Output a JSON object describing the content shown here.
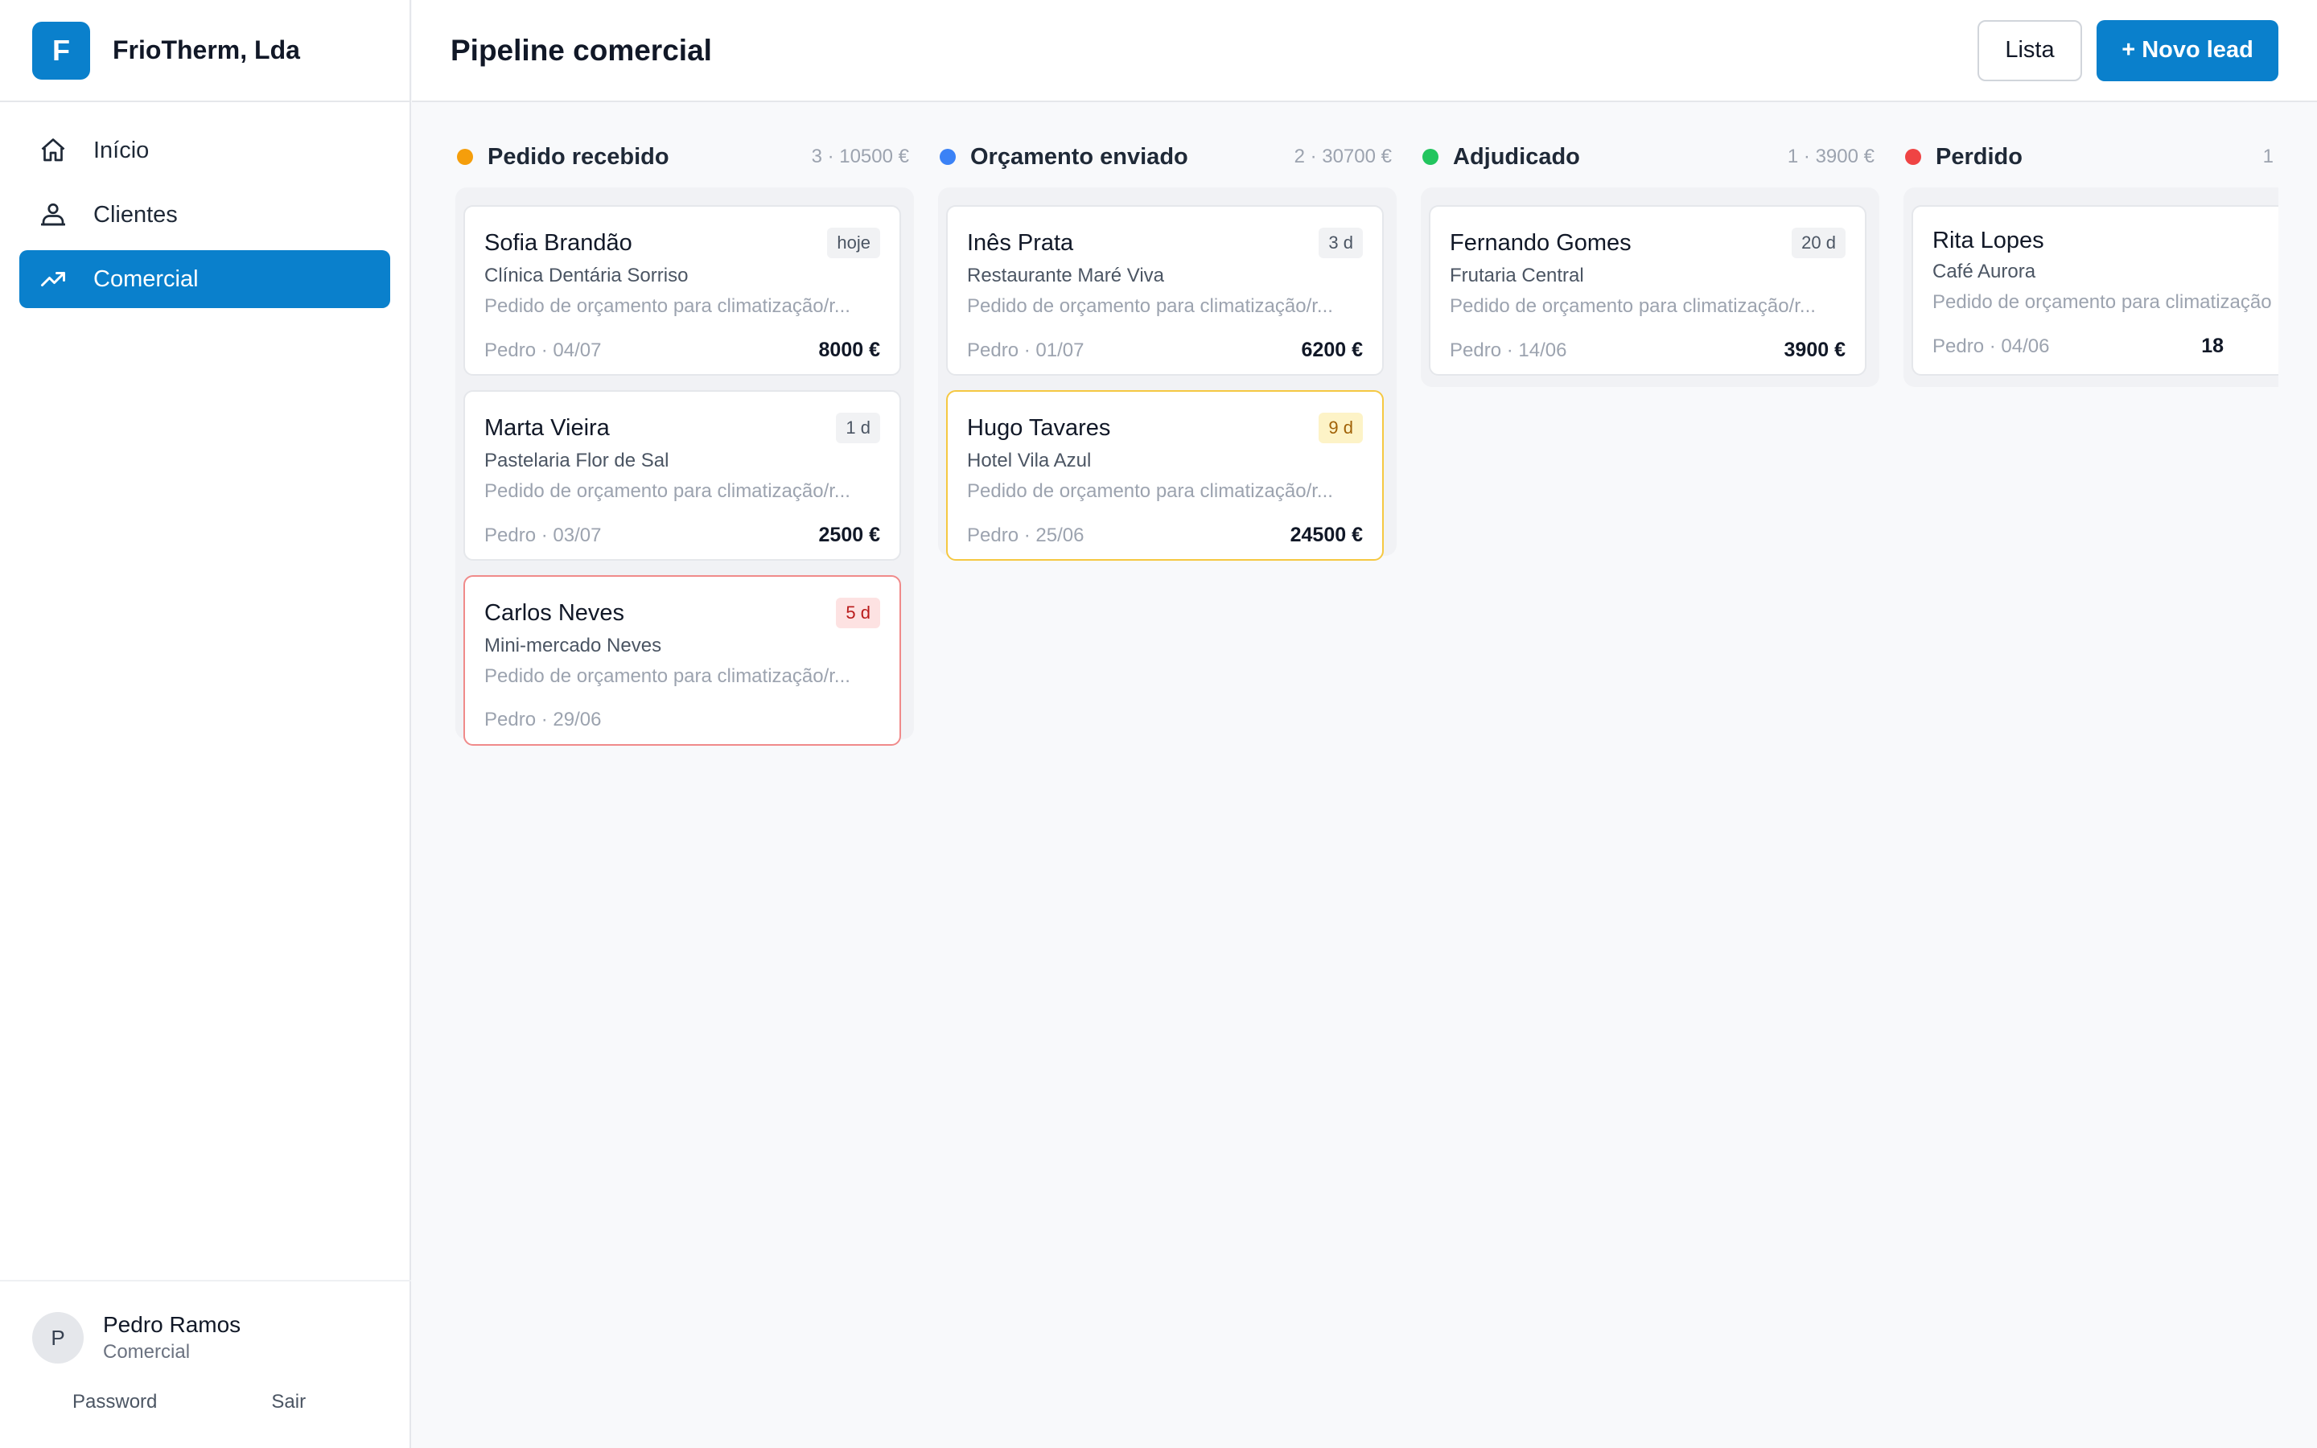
{
  "brand": {
    "initial": "F",
    "name": "FrioTherm, Lda"
  },
  "nav": {
    "items": [
      {
        "label": "Início",
        "icon": "home-icon",
        "active": false
      },
      {
        "label": "Clientes",
        "icon": "users-icon",
        "active": false
      },
      {
        "label": "Comercial",
        "icon": "trending-up-icon",
        "active": true
      }
    ]
  },
  "user": {
    "initial": "P",
    "name": "Pedro Ramos",
    "role": "Comercial",
    "password_label": "Password",
    "logout_label": "Sair"
  },
  "header": {
    "title": "Pipeline comercial",
    "list_button": "Lista",
    "new_lead_button": "+ Novo lead"
  },
  "colors": {
    "accent": "#0a80cc",
    "pending": "#f59e0b",
    "sent": "#3b82f6",
    "won": "#22c55e",
    "lost": "#ef4444"
  },
  "columns": [
    {
      "title": "Pedido recebido",
      "meta": "3 · 10500 €",
      "dot": "#f59e0b",
      "cards": [
        {
          "name": "Sofia Brandão",
          "badge": "hoje",
          "company": "Clínica Dentária Sorriso",
          "desc": "Pedido de orçamento para climatização/r...",
          "meta": "Pedro · 04/07",
          "value": "8000 €"
        },
        {
          "name": "Marta Vieira",
          "badge": "1 d",
          "company": "Pastelaria Flor de Sal",
          "desc": "Pedido de orçamento para climatização/r...",
          "meta": "Pedro · 03/07",
          "value": "2500 €"
        },
        {
          "name": "Carlos Neves",
          "badge": "5 d",
          "company": "Mini-mercado Neves",
          "desc": "Pedido de orçamento para climatização/r...",
          "meta": "Pedro · 29/06",
          "value": ""
        }
      ]
    },
    {
      "title": "Orçamento enviado",
      "meta": "2 · 30700 €",
      "dot": "#3b82f6",
      "cards": [
        {
          "name": "Inês Prata",
          "badge": "3 d",
          "company": "Restaurante Maré Viva",
          "desc": "Pedido de orçamento para climatização/r...",
          "meta": "Pedro · 01/07",
          "value": "6200 €"
        },
        {
          "name": "Hugo Tavares",
          "badge": "9 d",
          "company": "Hotel Vila Azul",
          "desc": "Pedido de orçamento para climatização/r...",
          "meta": "Pedro · 25/06",
          "value": "24500 €"
        }
      ]
    },
    {
      "title": "Adjudicado",
      "meta": "1 · 3900 €",
      "dot": "#22c55e",
      "cards": [
        {
          "name": "Fernando Gomes",
          "badge": "20 d",
          "company": "Frutaria Central",
          "desc": "Pedido de orçamento para climatização/r...",
          "meta": "Pedro · 14/06",
          "value": "3900 €"
        }
      ]
    },
    {
      "title": "Perdido",
      "meta": "1",
      "dot": "#ef4444",
      "cards": [
        {
          "name": "Rita Lopes",
          "badge": "",
          "company": "Café Aurora",
          "desc": "Pedido de orçamento para climatização",
          "meta": "Pedro · 04/06",
          "value": "18"
        }
      ]
    }
  ]
}
